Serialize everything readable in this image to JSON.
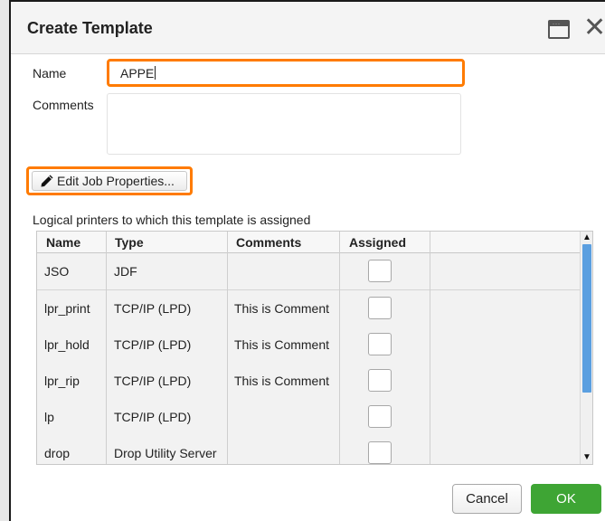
{
  "dialog": {
    "title": "Create Template",
    "maximize_icon": "window-maximize-icon",
    "close_icon": "close-icon"
  },
  "form": {
    "name_label": "Name",
    "name_value": "APPE",
    "comments_label": "Comments",
    "comments_value": "",
    "edit_button_label": "Edit Job Properties...",
    "edit_button_icon": "pencil-icon",
    "highlight_color": "#ff7b00"
  },
  "table": {
    "caption": "Logical printers to which this template is assigned",
    "columns": [
      "Name",
      "Type",
      "Comments",
      "Assigned"
    ],
    "rows": [
      {
        "name": "JSO",
        "type": "JDF",
        "comments": "",
        "assigned": false
      },
      {
        "name": "lpr_print",
        "type": "TCP/IP (LPD)",
        "comments": "This is Comment",
        "assigned": false
      },
      {
        "name": "lpr_hold",
        "type": "TCP/IP (LPD)",
        "comments": "This is Comment",
        "assigned": false
      },
      {
        "name": "lpr_rip",
        "type": "TCP/IP (LPD)",
        "comments": "This is Comment",
        "assigned": false
      },
      {
        "name": "lp",
        "type": "TCP/IP (LPD)",
        "comments": "",
        "assigned": false
      },
      {
        "name": "drop",
        "type": "Drop Utility Server",
        "comments": "",
        "assigned": false
      }
    ]
  },
  "footer": {
    "cancel_label": "Cancel",
    "ok_label": "OK",
    "ok_color": "#3ea534"
  }
}
